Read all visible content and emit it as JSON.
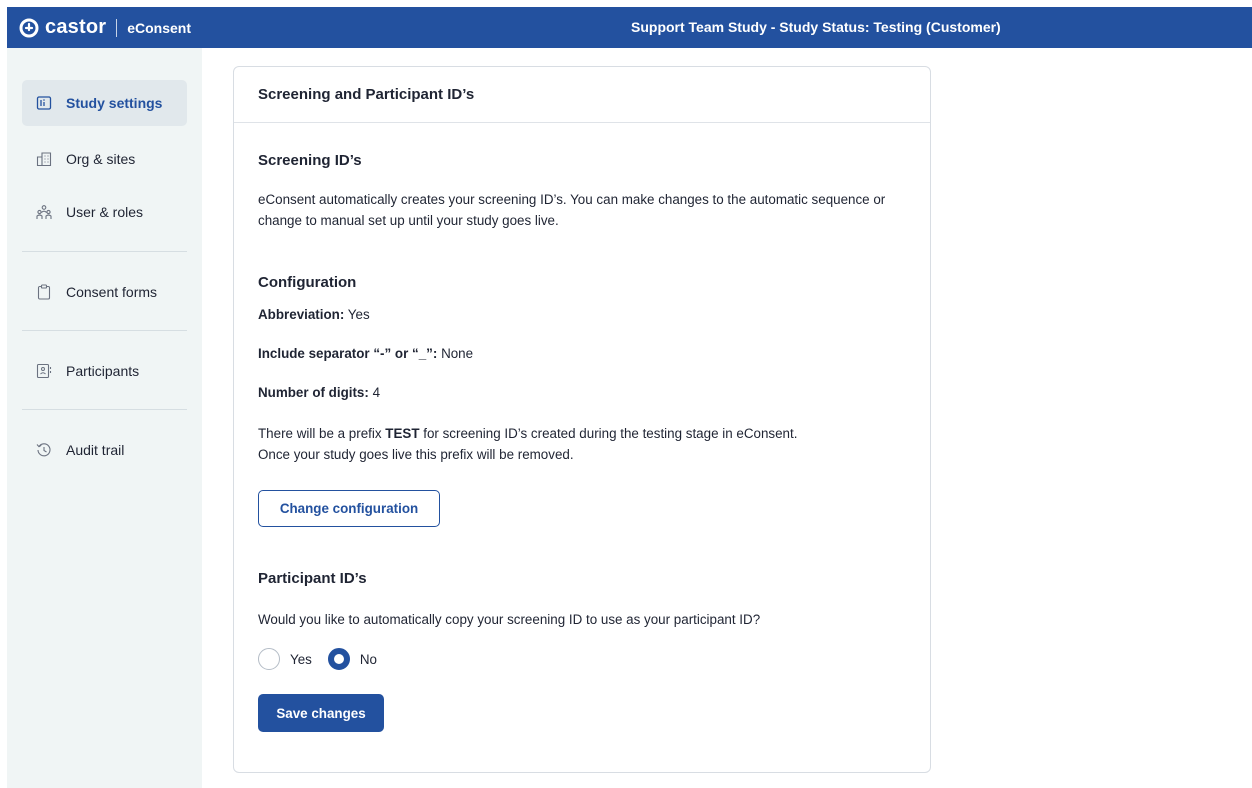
{
  "header": {
    "brand_name": "castor",
    "product": "eConsent",
    "study_status": "Support Team Study  - Study Status: Testing (Customer)"
  },
  "sidebar": {
    "items": [
      {
        "label": "Study settings",
        "icon": "info-square-icon",
        "active": true
      },
      {
        "label": "Org & sites",
        "icon": "building-icon"
      },
      {
        "label": "User & roles",
        "icon": "users-icon"
      },
      {
        "label": "Consent forms",
        "icon": "clipboard-icon"
      },
      {
        "label": "Participants",
        "icon": "id-card-icon"
      },
      {
        "label": "Audit trail",
        "icon": "history-icon"
      }
    ]
  },
  "card": {
    "title": "Screening and Participant ID’s",
    "screening": {
      "heading": "Screening ID’s",
      "description": "eConsent automatically creates your screening ID’s. You can make changes to the automatic sequence or change to manual set up until your study goes live."
    },
    "configuration": {
      "heading": "Configuration",
      "abbreviation_label": "Abbreviation:",
      "abbreviation_value": "Yes",
      "separator_label": "Include separator “-” or “_”:",
      "separator_value": "None",
      "digits_label": "Number of digits:",
      "digits_value": "4",
      "prefix_text_before": "There will be a prefix",
      "prefix_value": "TEST",
      "prefix_text_after": "for screening ID’s created during the testing stage in eConsent.",
      "prefix_note": "Once your study goes live this prefix will be removed.",
      "change_button": "Change configuration"
    },
    "participant": {
      "heading": "Participant ID’s",
      "question": "Would you like to automatically copy your screening ID to use as your participant ID?",
      "options": [
        {
          "label": "Yes",
          "checked": false
        },
        {
          "label": "No",
          "checked": true
        }
      ],
      "save_button": "Save changes"
    }
  },
  "colors": {
    "brand": "#23519f",
    "sidebar_bg": "#f0f5f5",
    "active_item_bg": "#e1e8ec",
    "text": "#1f2433"
  }
}
